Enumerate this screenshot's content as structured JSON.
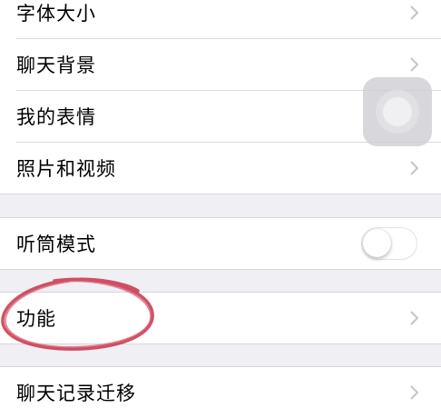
{
  "settings": {
    "group1": [
      {
        "label": "字体大小"
      },
      {
        "label": "聊天背景"
      },
      {
        "label": "我的表情"
      },
      {
        "label": "照片和视频"
      }
    ],
    "group2": [
      {
        "label": "听筒模式",
        "toggle_on": false
      }
    ],
    "group3": [
      {
        "label": "功能"
      }
    ],
    "group4": [
      {
        "label": "聊天记录迁移"
      }
    ]
  },
  "icons": {
    "chevron": "chevron-right-icon",
    "assistive_touch": "assistive-touch-icon"
  },
  "colors": {
    "background": "#efeff4",
    "chevron": "#c4c4c9",
    "annotation": "#c8324a"
  }
}
